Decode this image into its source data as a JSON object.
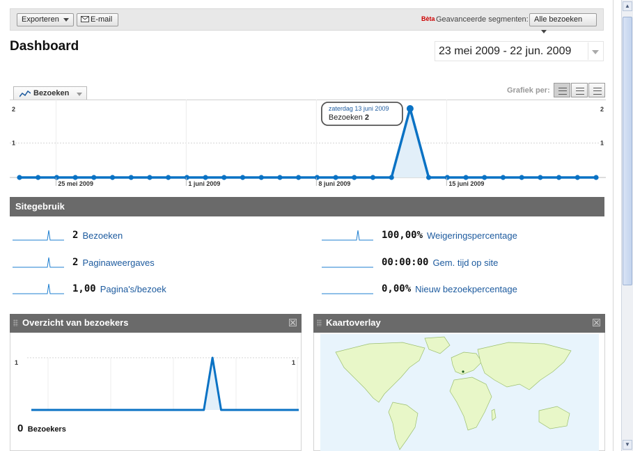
{
  "toolbar": {
    "export_label": "Exporteren",
    "email_label": "E-mail",
    "beta_label": "Bèta",
    "segments_label": "Geavanceerde segmenten:",
    "segments_value": "Alle bezoeken"
  },
  "header": {
    "title": "Dashboard",
    "date_range": "23 mei 2009 - 22 jun. 2009"
  },
  "chart_controls": {
    "metric_label": "Bezoeken",
    "graph_per_label": "Grafiek per:",
    "views": [
      "day",
      "week",
      "month"
    ]
  },
  "chart_data": [
    {
      "type": "line",
      "y_max_label": "2",
      "y_mid_label": "1",
      "ylim": [
        0,
        2
      ],
      "x_labels": [
        "25 mei 2009",
        "1 juni 2009",
        "8 juni 2009",
        "15 juni 2009"
      ],
      "series": [
        {
          "values": [
            0,
            0,
            0,
            0,
            0,
            0,
            0,
            0,
            0,
            0,
            0,
            0,
            0,
            0,
            0,
            0,
            0,
            0,
            0,
            0,
            0,
            2,
            0,
            0,
            0,
            0,
            0,
            0,
            0,
            0,
            0,
            0
          ]
        }
      ],
      "tooltip": {
        "date": "zaterdag 13 juni 2009",
        "metric": "Bezoeken",
        "value": "2"
      },
      "color": "#0a72c4",
      "fill": "#e2eff9"
    },
    {
      "type": "line",
      "y_label": "1",
      "ylim": [
        0,
        1
      ],
      "series": [
        {
          "values": [
            0,
            0,
            0,
            0,
            0,
            0,
            0,
            0,
            0,
            0,
            0,
            0,
            0,
            0,
            0,
            0,
            0,
            0,
            0,
            0,
            0,
            1,
            0,
            0,
            0,
            0,
            0,
            0,
            0,
            0,
            0,
            0
          ]
        }
      ],
      "color": "#0a72c4",
      "fill": "#e2eff9"
    }
  ],
  "site_usage": {
    "title": "Sitegebruik",
    "left": [
      {
        "value": "2",
        "label": "Bezoeken",
        "spark": "spike"
      },
      {
        "value": "2",
        "label": "Paginaweergaves",
        "spark": "spike"
      },
      {
        "value": "1,00",
        "label": "Pagina's/bezoek",
        "spark": "spike"
      }
    ],
    "right": [
      {
        "value": "100,00%",
        "label": "Weigeringspercentage",
        "spark": "spike"
      },
      {
        "value": "00:00:00",
        "label": "Gem. tijd op site",
        "spark": "flat"
      },
      {
        "value": "0,00%",
        "label": "Nieuw bezoekpercentage",
        "spark": "flat"
      }
    ]
  },
  "visitors_panel": {
    "title": "Overzicht van bezoekers",
    "value": "0",
    "label": "Bezoekers"
  },
  "map_panel": {
    "title": "Kaartoverlay",
    "ocean_color": "#e8f4fc",
    "land_color": "#e8f7c8"
  }
}
